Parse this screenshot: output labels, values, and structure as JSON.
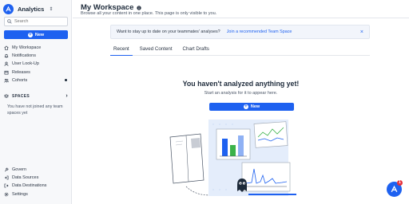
{
  "app": {
    "name": "Analytics"
  },
  "sidebar": {
    "search_placeholder": "Search",
    "new_label": "New",
    "items": [
      {
        "label": "My Workspace",
        "icon": "home-icon"
      },
      {
        "label": "Notifications",
        "icon": "bell-icon"
      },
      {
        "label": "User Look-Up",
        "icon": "user-icon"
      },
      {
        "label": "Releases",
        "icon": "releases-icon"
      },
      {
        "label": "Cohorts",
        "icon": "cohorts-icon"
      }
    ],
    "spaces_heading": "SPACES",
    "spaces_note": "You have not joined any team spaces yet",
    "bottom_items": [
      {
        "label": "Govern",
        "icon": "wrench-icon"
      },
      {
        "label": "Data Sources",
        "icon": "data-sources-icon"
      },
      {
        "label": "Data Destinations",
        "icon": "data-destinations-icon"
      },
      {
        "label": "Settings",
        "icon": "gear-icon"
      }
    ]
  },
  "header": {
    "title": "My Workspace",
    "subtitle": "Browse all your content in one place. This page is only visible to you."
  },
  "banner": {
    "text": "Want to stay up to date on your teammates' analyses?",
    "link": "Join a recommended Team Space"
  },
  "tabs": [
    {
      "label": "Recent",
      "active": true
    },
    {
      "label": "Saved Content",
      "active": false
    },
    {
      "label": "Chart Drafts",
      "active": false
    }
  ],
  "empty_state": {
    "title": "You haven't analyzed anything yet!",
    "subtitle": "Start an analysis for it to appear here.",
    "button_label": "New"
  },
  "helper": {
    "badge": "1"
  },
  "colors": {
    "accent": "#1e61f0",
    "badge": "#e5313b",
    "sidebar_bg": "#f7f8fa"
  }
}
